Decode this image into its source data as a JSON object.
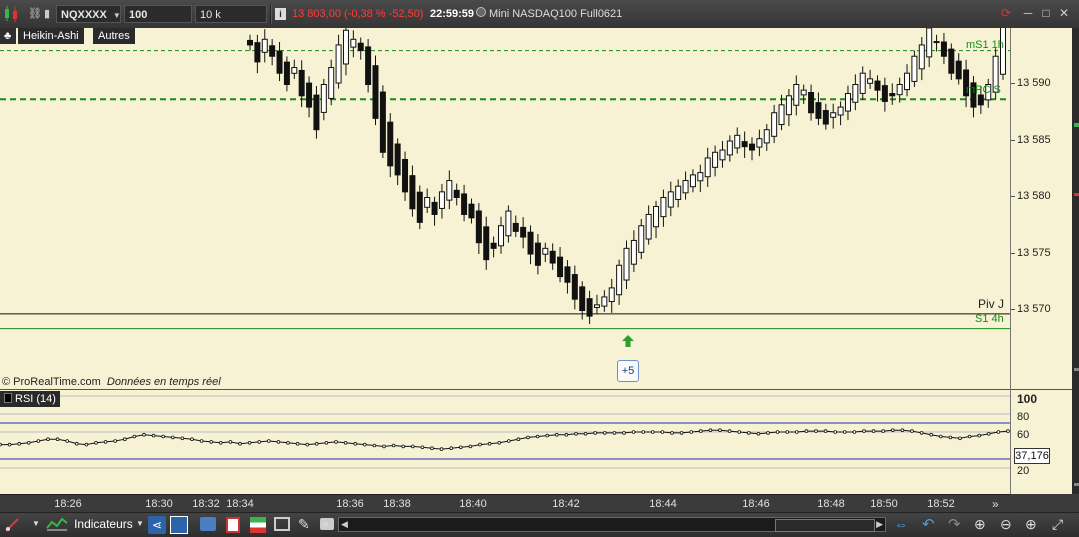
{
  "toolbar": {
    "symbol": "NQXXXX",
    "ticks": "100 ticks",
    "units": "10 k unités",
    "quote": "13 803,00 (-0,38 % -52,50)",
    "time": "22:59:59",
    "instrument": "Mini NASDAQ100 Full0621"
  },
  "chart": {
    "type_label": "Heikin-Ashi",
    "other_label": "Autres",
    "watermark_brand": "© ProRealTime.com",
    "watermark_note": "Données en temps réel",
    "plus_badge": "+5",
    "levels": [
      {
        "name": "mS1 1h",
        "price": 13593
      },
      {
        "name": "mPC S",
        "price": 13588.7
      },
      {
        "name": "Piv J",
        "price": 13569.7
      },
      {
        "name": "S1 4h",
        "price": 13568.4
      }
    ],
    "colors": {
      "bg": "#f6f2d3",
      "level_green": "#1a8a1a",
      "arrow": "#2e9e2e"
    }
  },
  "rsi": {
    "label": "RSI (14)",
    "value": "37,176",
    "current": 37.176,
    "upper": 70,
    "lower": 30
  },
  "axes": {
    "price_ticks": [
      "13 590",
      "13 585",
      "13 580",
      "13 575",
      "13 570"
    ],
    "rsi_ticks": [
      "100",
      "80",
      "60",
      "20"
    ],
    "time_ticks": [
      "18:26",
      "18:30",
      "18:32",
      "18:34",
      "18:36",
      "18:38",
      "18:40",
      "18:42",
      "18:44",
      "18:46",
      "18:48",
      "18:50",
      "18:52"
    ]
  },
  "bottombar": {
    "indicators_label": "Indicateurs"
  },
  "chart_data": {
    "type": "candlestick",
    "price_range": [
      13565,
      13595
    ],
    "rsi_range": [
      0,
      100
    ],
    "close_path": [
      13593.5,
      13592,
      13594,
      13592.5,
      13591,
      13590,
      13591.5,
      13589,
      13588,
      13586,
      13590,
      13591.5,
      13593.5,
      13594.8,
      13594,
      13593,
      13590,
      13587,
      13584,
      13582.8,
      13582,
      13580.5,
      13579,
      13577.8,
      13580,
      13578.5,
      13580.5,
      13581.5,
      13580,
      13578.5,
      13578.2,
      13576,
      13574.5,
      13575.5,
      13577.5,
      13578.8,
      13577,
      13576.5,
      13575,
      13574,
      13575.5,
      13574.2,
      13573,
      13572.5,
      13571,
      13570,
      13569.5,
      13570.5,
      13571.2,
      13572,
      13574,
      13575.5,
      13576.2,
      13577.5,
      13578.5,
      13579.2,
      13580,
      13580.5,
      13581,
      13581.5,
      13582,
      13582.2,
      13583.5,
      13584,
      13584.2,
      13585,
      13585.5,
      13584.5,
      13584.2,
      13585.2,
      13586,
      13587.5,
      13588.2,
      13589,
      13590,
      13589.5,
      13587.5,
      13587,
      13586.5,
      13587.5,
      13588,
      13589.2,
      13590,
      13591,
      13590.5,
      13589.5,
      13588.5,
      13589,
      13590,
      13591,
      13592.5,
      13593.5,
      13595,
      13593.8,
      13592.5,
      13591,
      13590.5,
      13589,
      13588,
      13588.2,
      13590,
      13592.5,
      13595.5
    ],
    "rsi_path": [
      46,
      46,
      47,
      48,
      50,
      52,
      52,
      50,
      47,
      46,
      48,
      49,
      50,
      52,
      55,
      57,
      56,
      55,
      54,
      53,
      52,
      50,
      49,
      48,
      49,
      47,
      48,
      49,
      50,
      49,
      48,
      47,
      46,
      47,
      48,
      49,
      48,
      47,
      46,
      45,
      44,
      45,
      44,
      44,
      43,
      42,
      41,
      42,
      43,
      44,
      46,
      47,
      48,
      50,
      52,
      54,
      55,
      56,
      57,
      57,
      58,
      58,
      59,
      59,
      59,
      59,
      60,
      60,
      60,
      60,
      59,
      59,
      60,
      61,
      62,
      62,
      61,
      60,
      59,
      58,
      59,
      60,
      60,
      60,
      61,
      61,
      61,
      60,
      60,
      60,
      61,
      61,
      61,
      62,
      62,
      61,
      59,
      57,
      55,
      54,
      53,
      55,
      56,
      58,
      60,
      61
    ]
  }
}
